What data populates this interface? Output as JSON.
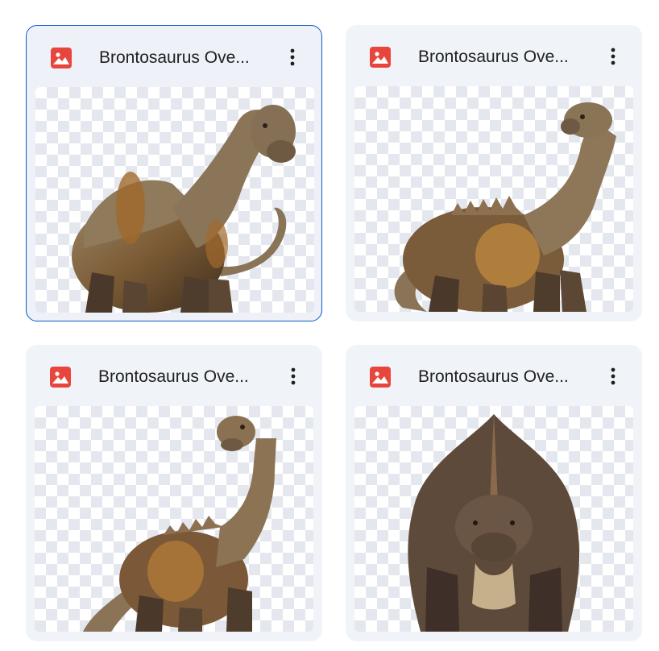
{
  "files": [
    {
      "name": "Brontosaurus Ove...",
      "type_icon": "image-icon",
      "selected": true,
      "pose": "walking-left-looking-right"
    },
    {
      "name": "Brontosaurus Ove...",
      "type_icon": "image-icon",
      "selected": false,
      "pose": "walking-left-looking-back"
    },
    {
      "name": "Brontosaurus Ove...",
      "type_icon": "image-icon",
      "selected": false,
      "pose": "standing-looking-up"
    },
    {
      "name": "Brontosaurus Ove...",
      "type_icon": "image-icon",
      "selected": false,
      "pose": "front-facing"
    }
  ],
  "colors": {
    "accent_selected": "#0b57d0",
    "image_icon": "#e8453c",
    "card_bg": "#f0f4f9"
  }
}
